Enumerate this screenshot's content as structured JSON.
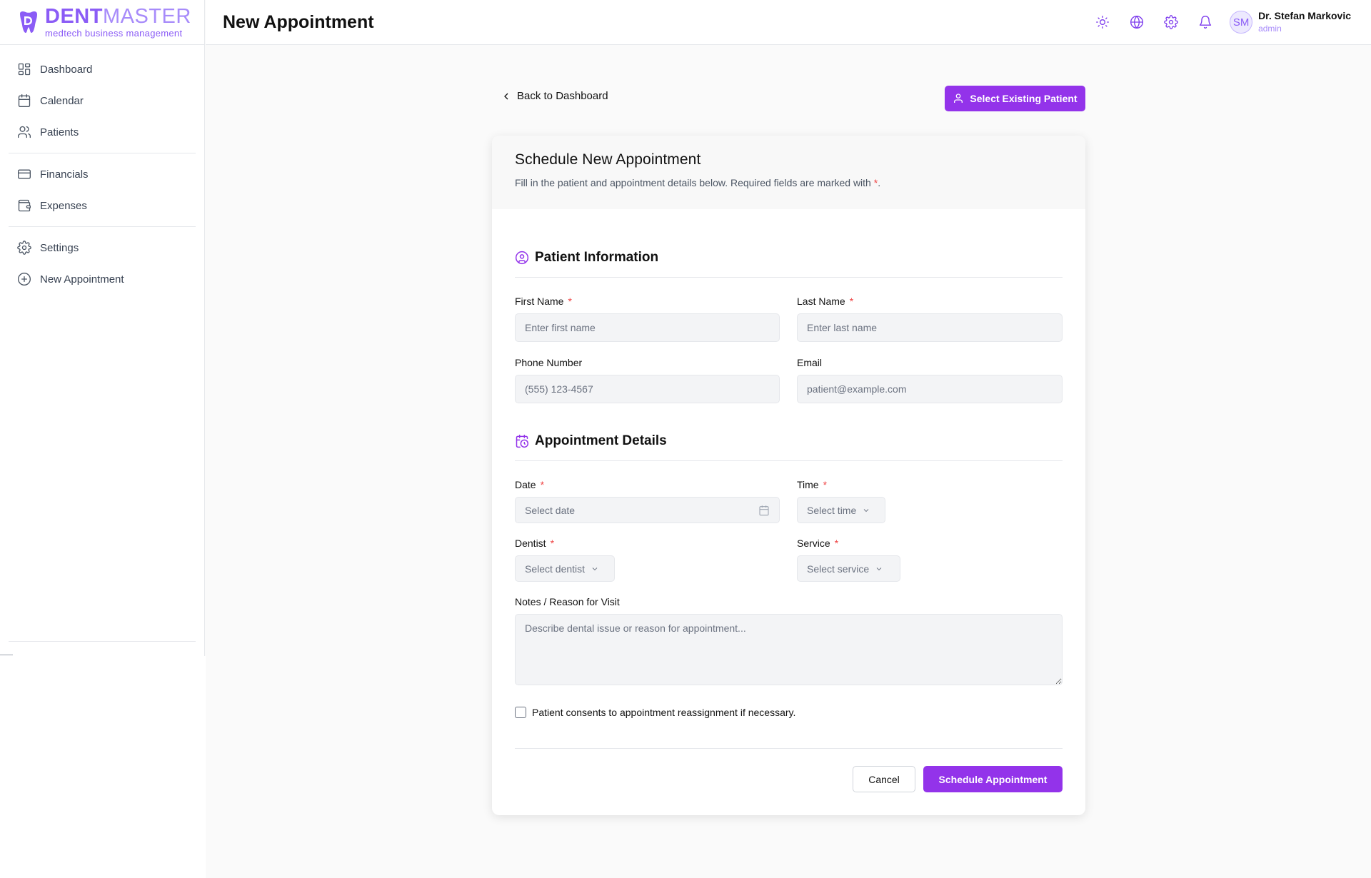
{
  "brand": {
    "title_bold": "DENT",
    "title_rest": "MASTER",
    "subtitle": "medtech business management"
  },
  "header": {
    "title": "New Appointment",
    "icons": [
      "sun-icon",
      "globe-icon",
      "gear-icon",
      "bell-icon"
    ],
    "user": {
      "initials": "SM",
      "name": "Dr. Stefan Markovic",
      "role": "admin"
    }
  },
  "sidebar": {
    "items": [
      {
        "label": "Dashboard",
        "icon": "dashboard-icon"
      },
      {
        "label": "Calendar",
        "icon": "calendar-icon"
      },
      {
        "label": "Patients",
        "icon": "users-icon"
      },
      {
        "label": "Financials",
        "icon": "credit-card-icon"
      },
      {
        "label": "Expenses",
        "icon": "wallet-icon"
      },
      {
        "label": "Settings",
        "icon": "gear-icon"
      },
      {
        "label": "New Appointment",
        "icon": "plus-circle-icon"
      }
    ]
  },
  "main": {
    "back_label": "Back to Dashboard",
    "select_existing_label": "Select Existing Patient"
  },
  "form": {
    "title": "Schedule New Appointment",
    "description": "Fill in the patient and appointment details below. Required fields are marked with",
    "required_marker": "*",
    "description_end": ".",
    "patient_section": "Patient Information",
    "appointment_section": "Appointment Details",
    "first_name": {
      "label": "First Name",
      "placeholder": "Enter first name",
      "required": "*"
    },
    "last_name": {
      "label": "Last Name",
      "placeholder": "Enter last name",
      "required": "*"
    },
    "phone": {
      "label": "Phone Number",
      "placeholder": "(555) 123-4567"
    },
    "email": {
      "label": "Email",
      "placeholder": "patient@example.com"
    },
    "date": {
      "label": "Date",
      "placeholder": "Select date",
      "required": "*"
    },
    "time": {
      "label": "Time",
      "placeholder": "Select time",
      "required": "*"
    },
    "dentist": {
      "label": "Dentist",
      "placeholder": "Select dentist",
      "required": "*"
    },
    "service": {
      "label": "Service",
      "placeholder": "Select service",
      "required": "*"
    },
    "notes": {
      "label": "Notes / Reason for Visit",
      "placeholder": "Describe dental issue or reason for appointment..."
    },
    "consent_label": "Patient consents to appointment reassignment if necessary.",
    "consent_checked": false,
    "cancel_label": "Cancel",
    "submit_label": "Schedule Appointment"
  },
  "colors": {
    "accent": "#9333ea",
    "brand": "#8b5cf6",
    "required": "#ef4444"
  }
}
